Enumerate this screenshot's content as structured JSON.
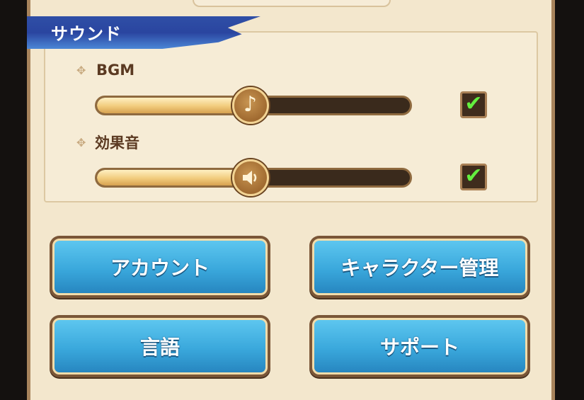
{
  "section": {
    "title": "サウンド"
  },
  "bgm": {
    "label": "BGM",
    "level": 0.49,
    "enabled": true,
    "icon": "music-note-icon",
    "check_glyph": "✔"
  },
  "sfx": {
    "label": "効果音",
    "level": 0.49,
    "enabled": true,
    "icon": "speaker-icon",
    "check_glyph": "✔"
  },
  "buttons": {
    "account": "アカウント",
    "character_manage": "キャラクター管理",
    "language": "言語",
    "support": "サポート"
  },
  "colors": {
    "ribbon": "#2f4fa6",
    "button_blue": "#3aa8dc",
    "check_green": "#63ef3f",
    "panel_bg": "#f3e7cd"
  }
}
